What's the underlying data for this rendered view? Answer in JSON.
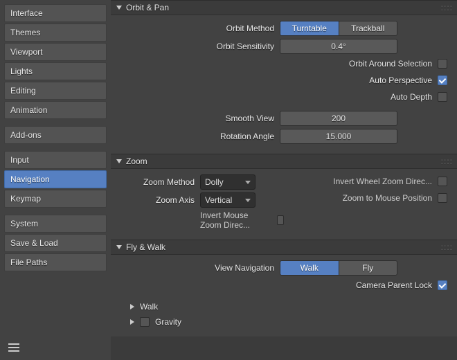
{
  "sidebar": {
    "groups": [
      [
        "Interface",
        "Themes",
        "Viewport",
        "Lights",
        "Editing",
        "Animation"
      ],
      [
        "Add-ons"
      ],
      [
        "Input",
        "Navigation",
        "Keymap"
      ],
      [
        "System",
        "Save & Load",
        "File Paths"
      ]
    ],
    "selected": "Navigation"
  },
  "orbit_pan": {
    "title": "Orbit & Pan",
    "method_label": "Orbit Method",
    "methods": [
      "Turntable",
      "Trackball"
    ],
    "method_active": "Turntable",
    "sensitivity_label": "Orbit Sensitivity",
    "sensitivity_value": "0.4°",
    "around_sel_label": "Orbit Around Selection",
    "around_sel": false,
    "auto_persp_label": "Auto Perspective",
    "auto_persp": true,
    "auto_depth_label": "Auto Depth",
    "auto_depth": false,
    "smooth_view_label": "Smooth View",
    "smooth_view": "200",
    "rot_angle_label": "Rotation Angle",
    "rot_angle": "15.000"
  },
  "zoom": {
    "title": "Zoom",
    "method_label": "Zoom Method",
    "method_value": "Dolly",
    "axis_label": "Zoom Axis",
    "axis_value": "Vertical",
    "invert_mouse_label": "Invert Mouse Zoom Direc...",
    "invert_mouse": false,
    "invert_wheel_label": "Invert Wheel Zoom Direc...",
    "invert_wheel": false,
    "to_mouse_label": "Zoom to Mouse Position",
    "to_mouse": false
  },
  "fly_walk": {
    "title": "Fly & Walk",
    "view_nav_label": "View Navigation",
    "modes": [
      "Walk",
      "Fly"
    ],
    "mode_active": "Walk",
    "cam_lock_label": "Camera Parent Lock",
    "cam_lock": true,
    "walk_sub": "Walk",
    "gravity_sub": "Gravity",
    "gravity": false
  }
}
